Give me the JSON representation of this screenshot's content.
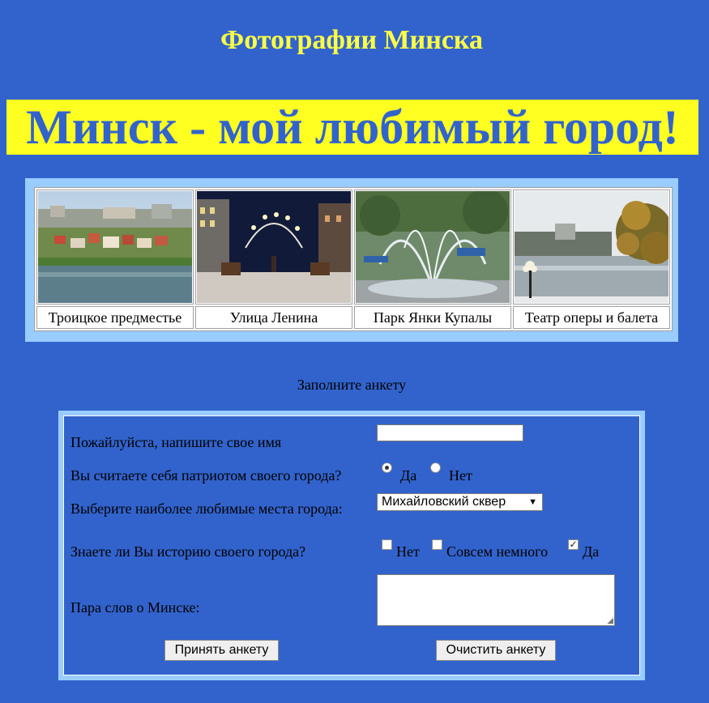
{
  "header": {
    "title": "Фотографии Минска",
    "banner": "Минск - мой любимый город!"
  },
  "gallery": {
    "items": [
      {
        "caption": "Троицкое предместье",
        "image": "photo-trinity-suburb"
      },
      {
        "caption": "Улица Ленина",
        "image": "photo-lenin-street"
      },
      {
        "caption": "Парк Янки Купалы",
        "image": "photo-yanka-kupala-park"
      },
      {
        "caption": "Театр оперы и балета",
        "image": "photo-opera-ballet-theatre"
      }
    ]
  },
  "survey": {
    "heading": "Заполните анкету",
    "name_label": "Пожайлуйста, напишите свое имя",
    "name_value": "",
    "patriot_label": "Вы считаете себя патриотом своего города?",
    "patriot_options": [
      {
        "label": "Да",
        "selected": true
      },
      {
        "label": "Нет",
        "selected": false
      }
    ],
    "places_label": "Выберите наиболее любимые места города:",
    "places_selected": "Михайловский сквер",
    "history_label": "Знаете ли Вы историю своего города?",
    "history_options": [
      {
        "label": "Нет",
        "checked": false
      },
      {
        "label": "Совсем немного",
        "checked": false
      },
      {
        "label": "Да",
        "checked": true
      }
    ],
    "words_label": "Пара слов о Минске:",
    "words_value": "",
    "submit_label": "Принять анкету",
    "reset_label": "Очистить анкету"
  },
  "colors": {
    "page_bg": "#3263cc",
    "title": "#ffff44",
    "banner_bg": "#ffff22",
    "frame": "#99ccff"
  }
}
